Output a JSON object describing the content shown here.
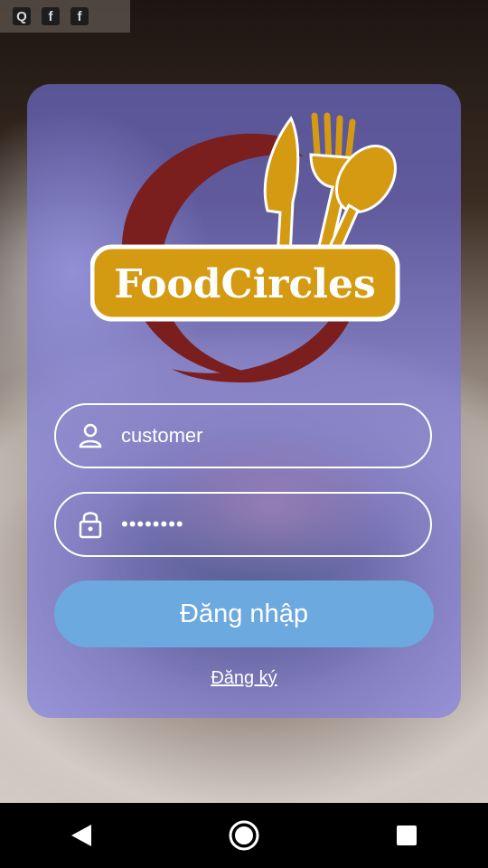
{
  "statusbar": {
    "icons": [
      "quora-icon",
      "facebook-icon",
      "facebook-icon"
    ],
    "glyphs": [
      "Q",
      "f",
      "f"
    ]
  },
  "logo": {
    "text": "FoodCircles"
  },
  "login_form": {
    "username": {
      "value": "customer",
      "icon": "user-icon"
    },
    "password": {
      "value": "••••••••",
      "icon": "lock-icon"
    },
    "login_button_label": "Đăng nhập",
    "register_link_label": "Đăng ký"
  },
  "colors": {
    "card": "#7878e6",
    "button": "#6ca9de",
    "logo_red": "#7a1e1e",
    "logo_gold": "#d49a12"
  },
  "navbar": {
    "icons": [
      "back-icon",
      "home-icon",
      "recents-icon"
    ]
  }
}
